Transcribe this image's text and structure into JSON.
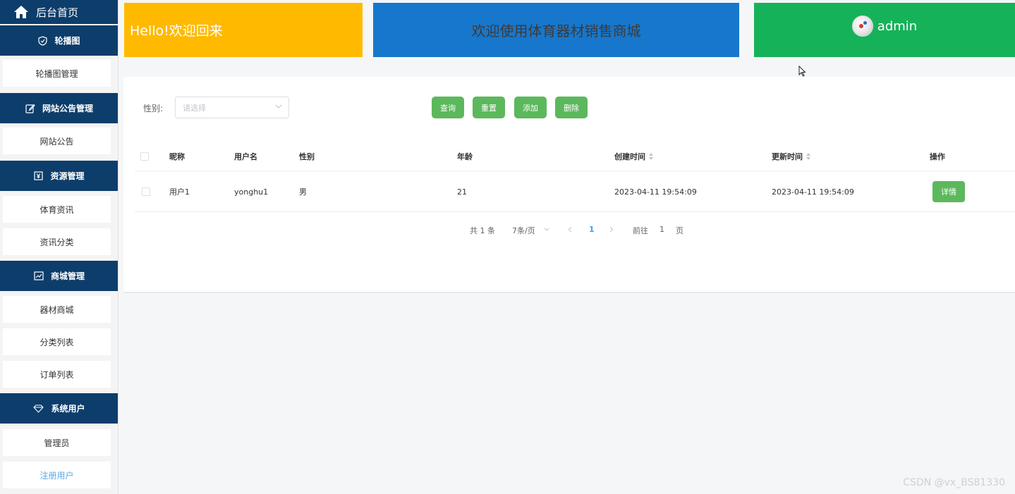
{
  "sidebar": {
    "home_label": "后台首页",
    "groups": [
      {
        "label": "轮播图",
        "items": [
          {
            "label": "轮播图管理"
          }
        ]
      },
      {
        "label": "网站公告管理",
        "items": [
          {
            "label": "网站公告"
          }
        ]
      },
      {
        "label": "资源管理",
        "items": [
          {
            "label": "体育资讯"
          },
          {
            "label": "资讯分类"
          }
        ]
      },
      {
        "label": "商城管理",
        "items": [
          {
            "label": "器材商城"
          },
          {
            "label": "分类列表"
          },
          {
            "label": "订单列表"
          }
        ]
      },
      {
        "label": "系统用户",
        "items": [
          {
            "label": "管理员"
          },
          {
            "label": "注册用户"
          }
        ]
      }
    ]
  },
  "header": {
    "welcome": "Hello!欢迎回来",
    "site_title": "欢迎使用体育器材销售商城",
    "username": "admin"
  },
  "filter": {
    "gender_label": "性别:",
    "gender_placeholder": "请选择",
    "buttons": {
      "query": "查询",
      "reset": "重置",
      "add": "添加",
      "delete": "删除"
    }
  },
  "table": {
    "columns": [
      "昵称",
      "用户名",
      "性别",
      "年龄",
      "创建时间",
      "更新时间",
      "操作"
    ],
    "rows": [
      {
        "nickname": "用户1",
        "username": "yonghu1",
        "gender": "男",
        "age": "21",
        "created": "2023-04-11 19:54:09",
        "updated": "2023-04-11 19:54:09",
        "action": "详情"
      }
    ]
  },
  "pagination": {
    "total": "共 1 条",
    "page_size": "7条/页",
    "current_page": "1",
    "goto_label": "前往",
    "goto_value": "1",
    "page_suffix": "页"
  },
  "watermark": "CSDN @vx_BS81330",
  "colors": {
    "sidebar_header": "#0d3d6b",
    "card_yellow": "#ffba00",
    "card_blue": "#1777cc",
    "card_green": "#16b25a",
    "button_green": "#5cb85c",
    "active_link": "#5aa9e6"
  }
}
